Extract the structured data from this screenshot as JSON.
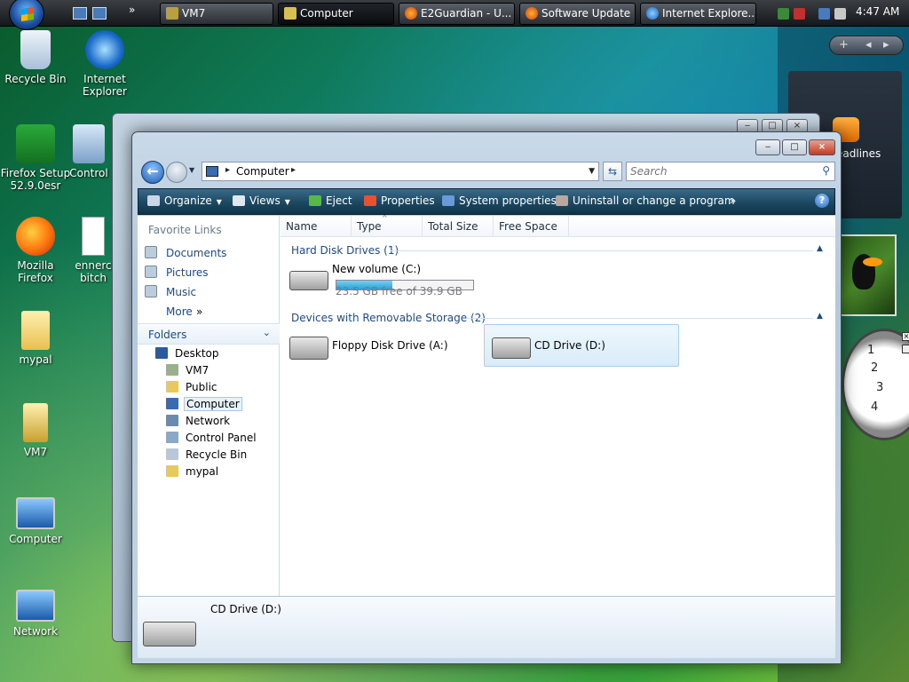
{
  "taskbar": {
    "buttons": [
      {
        "label": "VM7",
        "active": false
      },
      {
        "label": "Computer",
        "active": true
      },
      {
        "label": "E2Guardian - U...",
        "active": false
      },
      {
        "label": "Software Update",
        "active": false
      },
      {
        "label": "Internet Explore...",
        "active": false
      }
    ],
    "clock": "4:47 AM",
    "quicklaunch_more": "»"
  },
  "desktop_icons": [
    {
      "label": "Recycle Bin",
      "icon": "recycle-bin-icon"
    },
    {
      "label": "Internet Explorer",
      "icon": "internet-explorer-icon"
    },
    {
      "label": "Firefox Setup 52.9.0esr",
      "icon": "firefox-setup-icon"
    },
    {
      "label": "Control",
      "icon": "control-panel-icon"
    },
    {
      "label": "Mozilla Firefox",
      "icon": "firefox-icon"
    },
    {
      "label": "ennerc bitch",
      "icon": "document-icon"
    },
    {
      "label": "mypal",
      "icon": "folder-icon"
    },
    {
      "label": "VM7",
      "icon": "folder-icon"
    },
    {
      "label": "Computer",
      "icon": "computer-icon"
    },
    {
      "label": "Network",
      "icon": "network-icon"
    }
  ],
  "sidebar": {
    "feed_label": "eadlines",
    "clock_numbers": [
      "1",
      "2",
      "3",
      "4"
    ]
  },
  "window": {
    "title": "Computer",
    "address": {
      "location": "Computer"
    },
    "search_placeholder": "Search",
    "toolbar": {
      "organize": "Organize",
      "views": "Views",
      "eject": "Eject",
      "properties": "Properties",
      "system_properties": "System properties",
      "uninstall": "Uninstall or change a program",
      "more": "»"
    },
    "nav": {
      "favorite_links_title": "Favorite Links",
      "favorites": [
        "Documents",
        "Pictures",
        "Music",
        "More"
      ],
      "folders_title": "Folders",
      "tree": [
        "Desktop",
        "VM7",
        "Public",
        "Computer",
        "Network",
        "Control Panel",
        "Recycle Bin",
        "mypal"
      ]
    },
    "columns": [
      "Name",
      "Type",
      "Total Size",
      "Free Space"
    ],
    "groups": {
      "hard_disks": {
        "title": "Hard Disk Drives (1)",
        "drives": [
          {
            "name": "New volume (C:)",
            "free_text": "23.5 GB free of 39.9 GB",
            "used_fraction": 0.41
          }
        ]
      },
      "removable": {
        "title": "Devices with Removable Storage (2)",
        "drives": [
          {
            "name": "Floppy Disk Drive (A:)",
            "icon": "floppy-drive-icon"
          },
          {
            "name": "CD Drive (D:)",
            "icon": "cd-drive-icon",
            "selected": true
          }
        ]
      }
    },
    "details": {
      "name": "CD Drive (D:)"
    }
  }
}
